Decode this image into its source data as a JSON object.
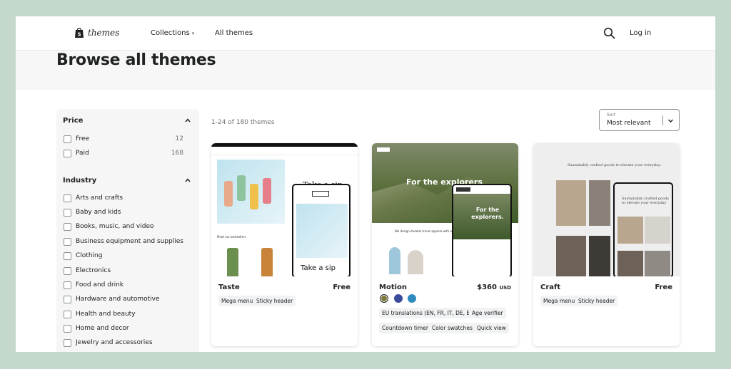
{
  "header": {
    "brand": "themes",
    "nav": {
      "collections": "Collections",
      "all_themes": "All themes"
    },
    "login": "Log in"
  },
  "hero": {
    "title": "Browse all themes"
  },
  "filters": {
    "price": {
      "title": "Price",
      "options": [
        {
          "label": "Free",
          "count": "12"
        },
        {
          "label": "Paid",
          "count": "168"
        }
      ]
    },
    "industry": {
      "title": "Industry",
      "options": [
        {
          "label": "Arts and crafts"
        },
        {
          "label": "Baby and kids"
        },
        {
          "label": "Books, music, and video"
        },
        {
          "label": "Business equipment and supplies"
        },
        {
          "label": "Clothing"
        },
        {
          "label": "Electronics"
        },
        {
          "label": "Food and drink"
        },
        {
          "label": "Hardware and automotive"
        },
        {
          "label": "Health and beauty"
        },
        {
          "label": "Home and decor"
        },
        {
          "label": "Jewelry and accessories"
        }
      ]
    }
  },
  "results": {
    "count_text": "1-24 of 180 themes",
    "sort": {
      "label": "Sort",
      "value": "Most relevant"
    }
  },
  "themes": [
    {
      "name": "Taste",
      "price": "Free",
      "tags": [
        "Mega menu",
        "Sticky header"
      ],
      "preview": {
        "heading": "Take a sip",
        "phone_heading": "Take a sip",
        "caption": "Meet our bestsellers"
      }
    },
    {
      "name": "Motion",
      "price": "$360",
      "currency": "USD",
      "swatches": [
        "#7d7a3a",
        "#3b4a9a",
        "#2f8bbf"
      ],
      "tags": [
        "EU translations (EN, FR, IT, DE, ES)",
        "Age verifier",
        "Countdown timer",
        "Color swatches",
        "Quick view"
      ],
      "preview": {
        "heading": "For the explorers",
        "phone_heading": "For the explorers.",
        "caption": "We design durable travel apparel with a conscience."
      }
    },
    {
      "name": "Craft",
      "price": "Free",
      "tags": [
        "Mega menu",
        "Sticky header"
      ],
      "preview": {
        "heading": "Sustainably crafted goods to elevate your everyday.",
        "phone_heading": "Sustainably crafted goods to elevate your everyday"
      }
    }
  ],
  "colors": {
    "background": "#c4d9cc",
    "sidebar": "#f6f6f7",
    "text": "#202223",
    "muted": "#6d7175"
  }
}
